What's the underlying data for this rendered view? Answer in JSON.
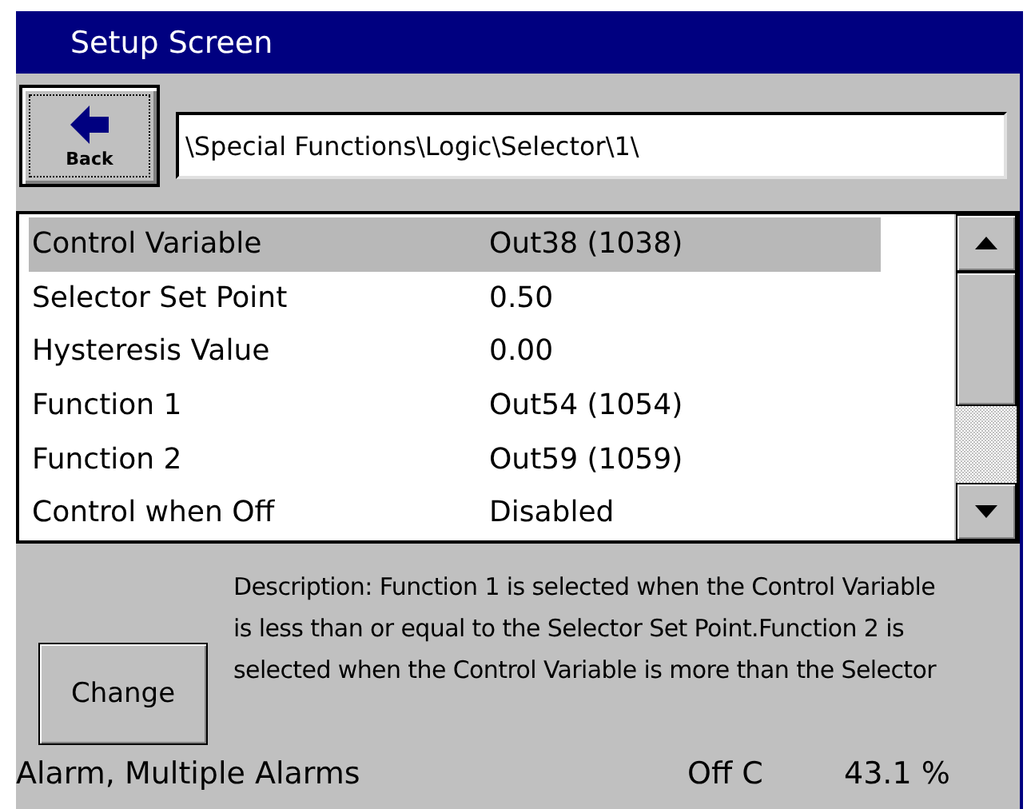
{
  "window": {
    "title": "Setup Screen"
  },
  "back_button": {
    "label": "Back"
  },
  "path_field": {
    "value": "\\Special Functions\\Logic\\Selector\\1\\"
  },
  "parameters": [
    {
      "label": "Control Variable",
      "value": "Out38 (1038)",
      "selected": true
    },
    {
      "label": "Selector Set Point",
      "value": "0.50",
      "selected": false
    },
    {
      "label": "Hysteresis Value",
      "value": "0.00",
      "selected": false
    },
    {
      "label": "Function 1",
      "value": "Out54 (1054)",
      "selected": false
    },
    {
      "label": "Function 2",
      "value": "Out59 (1059)",
      "selected": false
    },
    {
      "label": "Control when Off",
      "value": "Disabled",
      "selected": false
    }
  ],
  "change_button": {
    "label": "Change"
  },
  "description": "Description:  Function 1 is selected when the Control Variable is less than or equal to the Selector Set Point.Function 2 is selected when the Control Variable is more than the Selector",
  "status_bar": {
    "alarm": "Alarm, Multiple Alarms",
    "mode": "Off C",
    "output": "43.1 %"
  }
}
